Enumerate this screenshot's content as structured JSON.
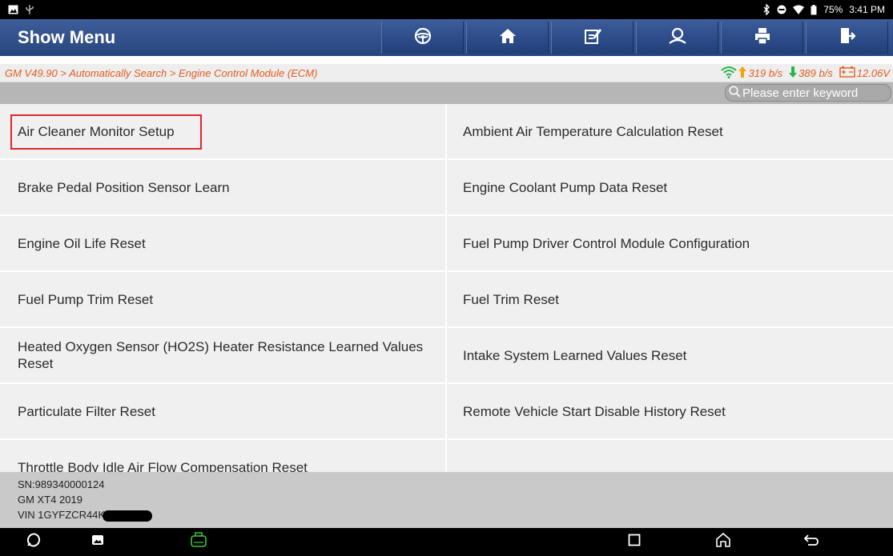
{
  "status_bar": {
    "battery_pct": "75%",
    "time": "3:41 PM",
    "icons": [
      "image-icon",
      "usb-icon",
      "bluetooth-icon",
      "dnd-icon",
      "wifi-icon",
      "battery-icon"
    ]
  },
  "header": {
    "title": "Show Menu",
    "toolbar": [
      {
        "name": "steering-wheel-icon"
      },
      {
        "name": "home-icon"
      },
      {
        "name": "edit-report-icon"
      },
      {
        "name": "user-icon"
      },
      {
        "name": "print-icon"
      },
      {
        "name": "exit-icon"
      }
    ]
  },
  "breadcrumb": {
    "path": "GM V49.90 > Automatically Search > Engine Control Module (ECM)",
    "upload": "319 b/s",
    "download": "389 b/s",
    "voltage": "12.06V"
  },
  "search": {
    "placeholder": "Please enter keyword"
  },
  "menu": {
    "items": [
      "Air Cleaner Monitor Setup",
      "Ambient Air Temperature Calculation Reset",
      "Brake Pedal Position Sensor Learn",
      "Engine Coolant Pump Data Reset",
      "Engine Oil Life Reset",
      "Fuel Pump Driver Control Module Configuration",
      "Fuel Pump Trim Reset",
      "Fuel Trim Reset",
      "Heated Oxygen Sensor (HO2S) Heater Resistance Learned Values Reset",
      "Intake System Learned Values Reset",
      "Particulate Filter Reset",
      "Remote Vehicle Start Disable History Reset",
      "Throttle Body Idle Air Flow Compensation Reset",
      ""
    ],
    "highlighted_index": 0
  },
  "vehicle": {
    "sn": "SN:989340000124",
    "model": "GM XT4 2019",
    "vin": "VIN 1GYFZCR44K"
  },
  "colors": {
    "header": "#2f4d86",
    "breadcrumb_text": "#e35b1e",
    "highlight": "#e0262b",
    "vci": "#3cc83c"
  }
}
